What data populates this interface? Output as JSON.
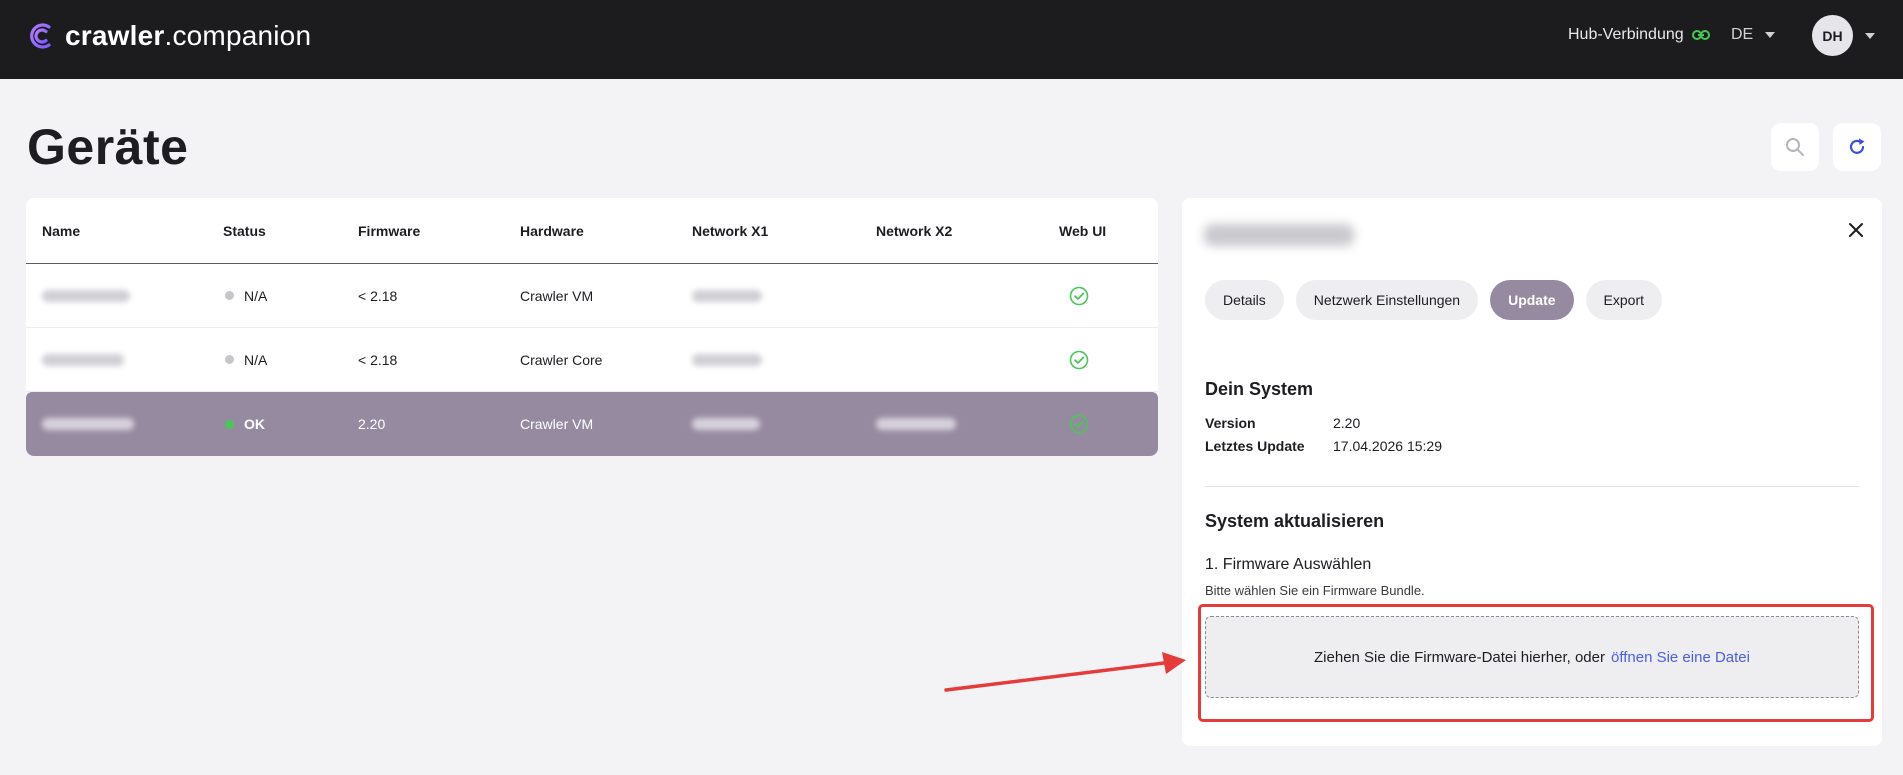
{
  "header": {
    "brand_bold": "crawler",
    "brand_light": ".companion",
    "hub_label": "Hub-Verbindung",
    "language": "DE",
    "user_initials": "DH"
  },
  "page": {
    "title": "Geräte"
  },
  "table": {
    "columns": [
      "Name",
      "Status",
      "Firmware",
      "Hardware",
      "Network X1",
      "Network X2",
      "Web UI"
    ],
    "rows": [
      {
        "status": "N/A",
        "firmware": "< 2.18",
        "hardware": "Crawler VM",
        "status_color": "#c6c6cb",
        "selected": false
      },
      {
        "status": "N/A",
        "firmware": "< 2.18",
        "hardware": "Crawler Core",
        "status_color": "#c6c6cb",
        "selected": false
      },
      {
        "status": "OK",
        "firmware": "2.20",
        "hardware": "Crawler VM",
        "status_color": "#48c758",
        "selected": true
      }
    ]
  },
  "panel": {
    "tabs": [
      "Details",
      "Netzwerk Einstellungen",
      "Update",
      "Export"
    ],
    "active_tab": "Update",
    "system_title": "Dein System",
    "version_label": "Version",
    "version_value": "2.20",
    "last_update_label": "Letztes Update",
    "last_update_value": "17.04.2026 15:29",
    "update_title": "System aktualisieren",
    "step_title": "1. Firmware Auswählen",
    "step_hint": "Bitte wählen Sie ein Firmware Bundle.",
    "dropzone_text": "Ziehen Sie die Firmware-Datei hierher, oder",
    "dropzone_link": "öffnen Sie eine Datei"
  },
  "colors": {
    "accent": "#968aa0",
    "link": "#4a5ee8",
    "ok": "#48c758",
    "highlight": "#e53b3b",
    "header_bg": "#1c1c1e"
  }
}
